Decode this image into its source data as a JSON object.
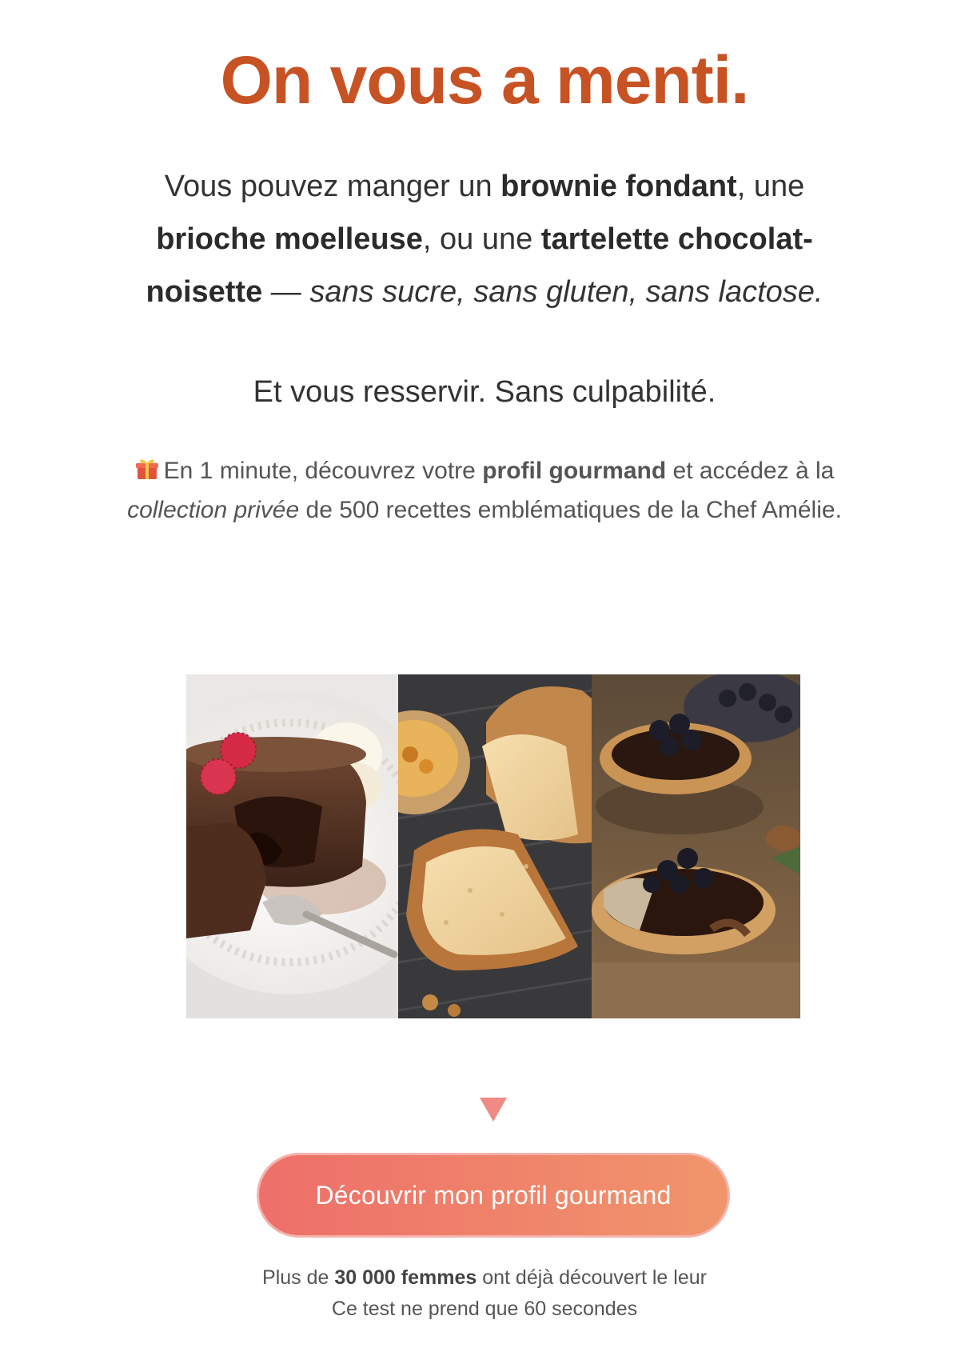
{
  "headline": "On vous a menti.",
  "intro": {
    "p1": "Vous pouvez manger un ",
    "b1": "brownie fondant",
    "p2": ", une ",
    "b2": "brioche moelleuse",
    "p3": ", ou une ",
    "b3": "tartelette chocolat-noisette",
    "p4": " — ",
    "italic": "sans sucre, sans gluten, sans lactose."
  },
  "tagline": "Et vous resservir. Sans culpabilité.",
  "offer": {
    "icon": "gift-icon",
    "p1": "En 1 minute, découvrez votre ",
    "b1": "profil gourmand",
    "p2": " et accédez à la ",
    "i1": "collection privée",
    "p3": " de 500 recettes emblématiques de la Chef Amélie."
  },
  "images": [
    {
      "icon": "chocolate-lava-cake-photo"
    },
    {
      "icon": "brioche-bread-photo"
    },
    {
      "icon": "chocolate-tartlet-photo"
    }
  ],
  "arrow_icon": "triangle-down-icon",
  "cta": {
    "label": "Découvrir mon profil gourmand"
  },
  "social": {
    "p1": "Plus de ",
    "b1": "30 000 femmes",
    "p2": " ont déjà découvert le leur",
    "line2": "Ce test ne prend que 60 secondes"
  },
  "colors": {
    "headline": "#c75224",
    "cta_start": "#ee6f6a",
    "cta_end": "#f0956b",
    "arrow": "#f08a85"
  }
}
